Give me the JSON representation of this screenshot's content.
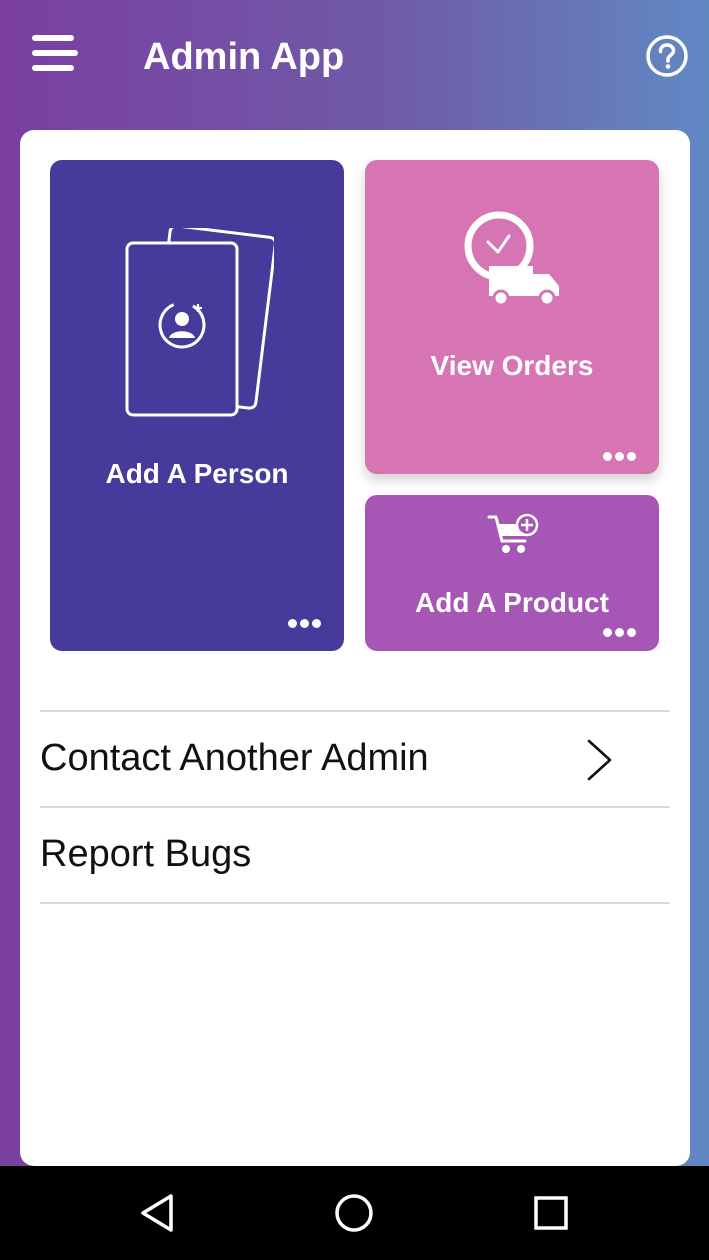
{
  "app": {
    "title": "Admin App"
  },
  "header": {
    "menu_icon": "hamburger-menu-icon",
    "help_icon": "help-circle-icon"
  },
  "tiles": [
    {
      "label": "Add A Person",
      "icon": "contact-cards-add-icon",
      "more_icon": "more-dots-icon",
      "color": "#463a9b"
    },
    {
      "label": "View Orders",
      "icon": "clock-delivery-truck-icon",
      "more_icon": "more-dots-icon",
      "color": "#d674b4"
    },
    {
      "label": "Add A Product",
      "icon": "cart-add-icon",
      "more_icon": "more-dots-icon",
      "color": "#a656b5"
    }
  ],
  "list": [
    {
      "label": "Contact Another Admin",
      "icon": "chevron-right-icon"
    },
    {
      "label": "Report Bugs"
    }
  ],
  "navbar": {
    "back_icon": "back-triangle-icon",
    "home_icon": "home-circle-icon",
    "recents_icon": "recents-square-icon"
  }
}
